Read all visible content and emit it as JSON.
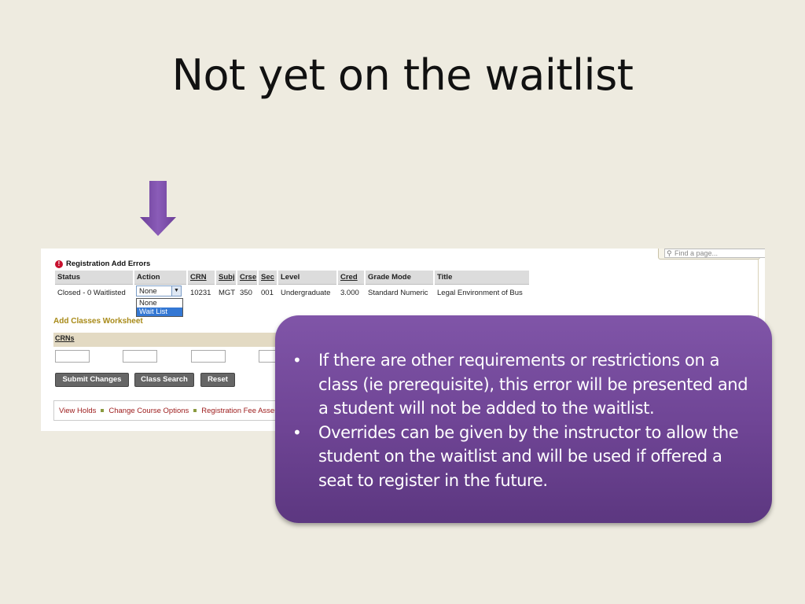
{
  "slide": {
    "title": "Not yet on the waitlist"
  },
  "screenshot": {
    "find_placeholder": "Find a page...",
    "error_heading": "Registration Add Errors",
    "columns": [
      "Status",
      "Action",
      "CRN",
      "Subj",
      "Crse",
      "Sec",
      "Level",
      "Cred",
      "Grade Mode",
      "Title"
    ],
    "row": {
      "status": "Closed - 0 Waitlisted",
      "action_selected": "None",
      "crn": "10231",
      "subj": "MGT",
      "crse": "350",
      "sec": "001",
      "level": "Undergraduate",
      "cred": "3.000",
      "grade_mode": "Standard Numeric",
      "title": "Legal Environment of Bus"
    },
    "action_options": [
      "None",
      "Wait List"
    ],
    "worksheet_title": "Add Classes Worksheet",
    "crns_label": "CRNs",
    "buttons": {
      "submit": "Submit Changes",
      "search": "Class Search",
      "reset": "Reset"
    },
    "links": [
      "View Holds",
      "Change Course Options",
      "Registration Fee Assessm"
    ]
  },
  "callout": {
    "bullets": [
      "If there are other requirements or restrictions on a class (ie prerequisite), this error will be presented and a student will not be added to the waitlist.",
      "Overrides can be given by the instructor to allow the student on the waitlist and will be used if offered a seat to register in the future."
    ]
  },
  "colors": {
    "background": "#eeebe0",
    "arrow": "#7b4fa6",
    "callout": "#6e4494",
    "worksheet_title": "#a88a18",
    "link": "#9c1a1a",
    "selected_option": "#3478d4"
  },
  "icons": [
    "down-arrow-icon",
    "error-icon",
    "search-icon",
    "dropdown-caret-icon"
  ]
}
